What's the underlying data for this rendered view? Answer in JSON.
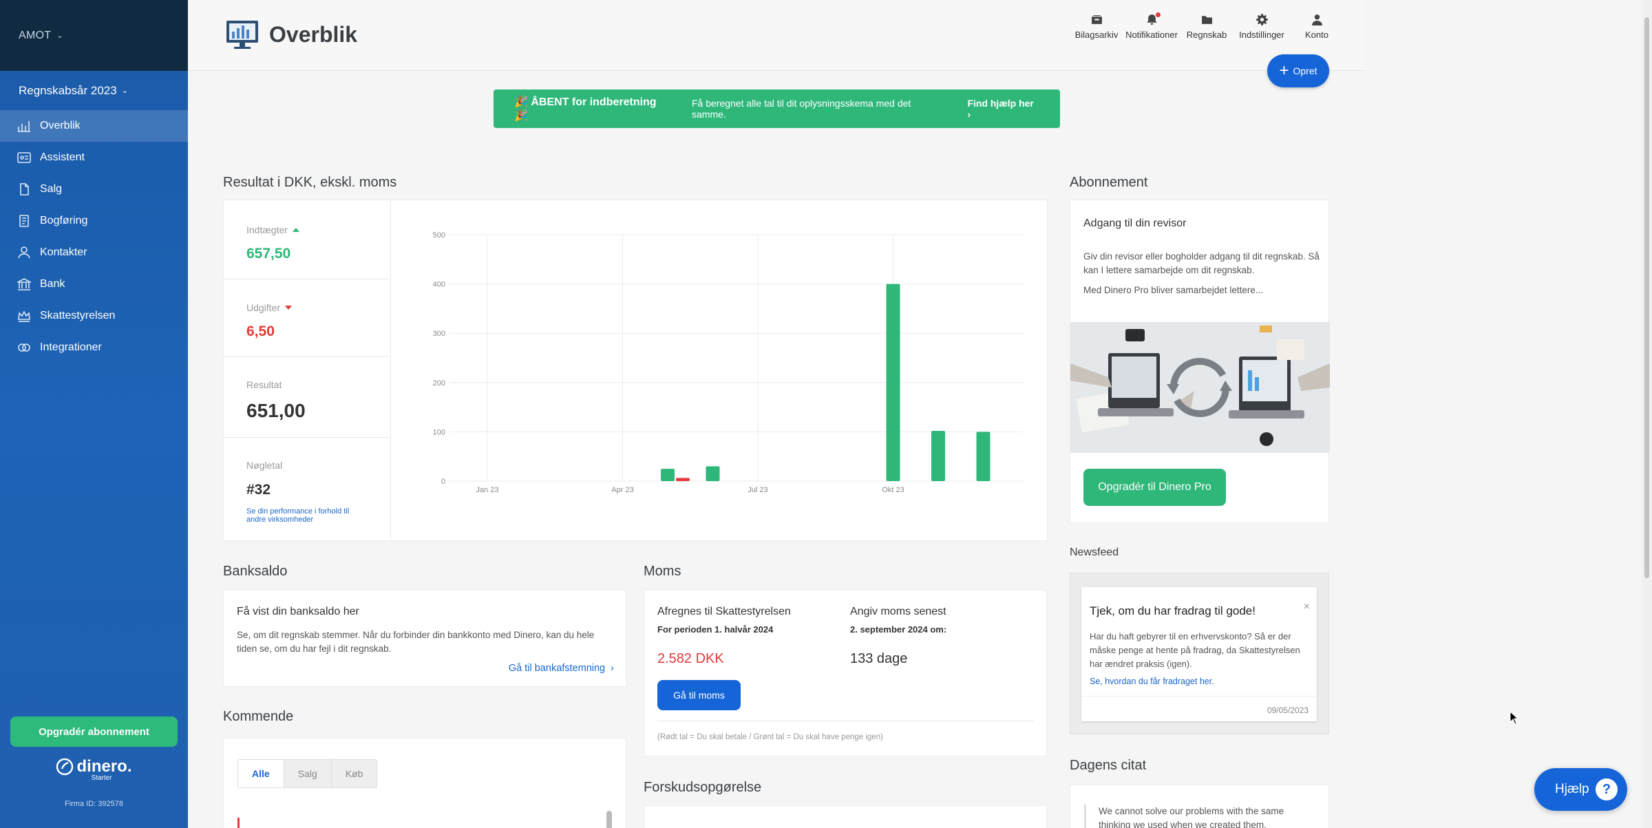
{
  "sidebar": {
    "company": "AMOT",
    "fiscal_year": "Regnskabsår 2023",
    "items": [
      {
        "label": "Overblik",
        "icon": "chart-bar-icon"
      },
      {
        "label": "Assistent",
        "icon": "assistant-icon"
      },
      {
        "label": "Salg",
        "icon": "document-icon"
      },
      {
        "label": "Bogføring",
        "icon": "ledger-icon"
      },
      {
        "label": "Kontakter",
        "icon": "person-icon"
      },
      {
        "label": "Bank",
        "icon": "bank-icon"
      },
      {
        "label": "Skattestyrelsen",
        "icon": "crown-icon"
      },
      {
        "label": "Integrationer",
        "icon": "integration-icon"
      }
    ],
    "upgrade_label": "Opgradér abonnement",
    "brand": "dinero.",
    "tier": "Starter",
    "firma_id": "Firma ID: 392578"
  },
  "header": {
    "title": "Overblik",
    "nav": [
      {
        "label": "Bilagsarkiv",
        "icon": "archive-icon"
      },
      {
        "label": "Notifikationer",
        "icon": "bell-icon"
      },
      {
        "label": "Regnskab",
        "icon": "folder-icon"
      },
      {
        "label": "Indstillinger",
        "icon": "gear-icon"
      },
      {
        "label": "Konto",
        "icon": "user-icon"
      }
    ],
    "create_label": "Opret"
  },
  "banner": {
    "title": "🎉 ÅBENT for indberetning 🎉",
    "text": "Få beregnet alle tal til dit oplysningsskema med det samme.",
    "link": "Find hjælp her  ›"
  },
  "result": {
    "title": "Resultat i DKK, ekskl. moms",
    "income_label": "Indtægter",
    "income_value": "657,50",
    "expense_label": "Udgifter",
    "expense_value": "6,50",
    "result_label": "Resultat",
    "result_value": "651,00",
    "kpi_label": "Nøgletal",
    "kpi_value": "#32",
    "kpi_link": "Se din performance i forhold til andre virksomheder"
  },
  "chart_data": {
    "type": "bar",
    "title": "",
    "x_ticks": [
      "Jan 23",
      "Apr 23",
      "Jul 23",
      "Okt 23"
    ],
    "y_ticks": [
      0,
      100,
      200,
      300,
      400,
      500
    ],
    "ylim": [
      0,
      500
    ],
    "categories": [
      "Jan 23",
      "Feb 23",
      "Mar 23",
      "Apr 23",
      "Maj 23",
      "Jun 23",
      "Jul 23",
      "Aug 23",
      "Sep 23",
      "Okt 23",
      "Nov 23",
      "Dec 23"
    ],
    "series": [
      {
        "values": [
          0,
          0,
          0,
          0,
          25,
          30,
          0,
          0,
          0,
          400,
          102,
          100
        ],
        "color": "#2fb779"
      },
      {
        "values": [
          0,
          0,
          0,
          0,
          6.5,
          0,
          0,
          0,
          0,
          0,
          0,
          0
        ],
        "color": "#e13b3b"
      }
    ],
    "grid": true
  },
  "subscription": {
    "section_title": "Abonnement",
    "heading": "Adgang til din revisor",
    "para1": "Giv din revisor eller bogholder adgang til dit regnskab. Så kan I lettere samarbejde om dit regnskab.",
    "para2": "Med Dinero Pro bliver samarbejdet lettere...",
    "button": "Opgradér til Dinero Pro"
  },
  "newsfeed": {
    "section_title": "Newsfeed",
    "title": "Tjek, om du har fradrag til gode!",
    "body": "Har du haft gebyrer til en erhvervskonto? Så er der måske penge at hente på fradrag, da Skattestyrelsen har ændret praksis (igen).",
    "link": "Se, hvordan du får fradraget her.",
    "date": "09/05/2023",
    "close": "×"
  },
  "quote": {
    "section_title": "Dagens citat",
    "text": "We cannot solve our problems with the same thinking we used when we created them."
  },
  "bank": {
    "section_title": "Banksaldo",
    "heading": "Få vist din banksaldo her",
    "body": "Se, om dit regnskab stemmer. Når du forbinder din bankkonto med Dinero, kan du hele tiden se, om du har fejl i dit regnskab.",
    "link": "Gå til bankafstemning"
  },
  "moms": {
    "section_title": "Moms",
    "col1_heading": "Afregnes til Skattestyrelsen",
    "col1_sub": "For perioden 1. halvår 2024",
    "amount": "2.582 DKK",
    "col2_heading": "Angiv moms senest",
    "col2_sub": "2. september 2024 om:",
    "days": "133 dage",
    "button": "Gå til moms",
    "note": "(Rødt tal = Du skal betale / Grønt tal = Du skal have penge igen)"
  },
  "upcoming": {
    "section_title": "Kommende",
    "tabs": [
      "Alle",
      "Salg",
      "Køb"
    ]
  },
  "forskud": {
    "section_title": "Forskudsopgørelse"
  },
  "help": {
    "label": "Hjælp"
  }
}
